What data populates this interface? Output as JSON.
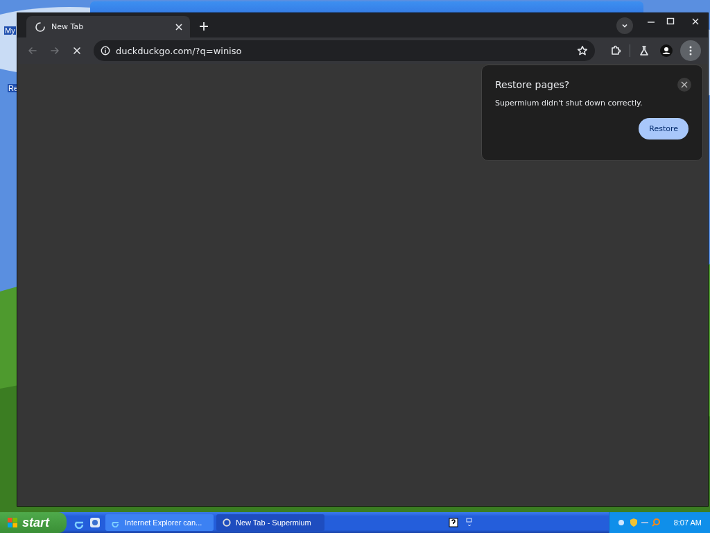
{
  "desktop": {
    "icons": [
      {
        "label": "My"
      },
      {
        "label": "Re"
      }
    ]
  },
  "browser": {
    "tabs": [
      {
        "title": "New Tab",
        "selected": true
      }
    ],
    "address": {
      "value": "duckduckgo.com/?q=winiso"
    },
    "popup": {
      "title": "Restore pages?",
      "message": "Supermium didn't shut down correctly.",
      "button": "Restore"
    }
  },
  "taskbar": {
    "start": "start",
    "tasks": [
      {
        "label": "Internet Explorer can...",
        "selected": false
      },
      {
        "label": "New Tab - Supermium",
        "selected": true
      }
    ],
    "clock": "8:07 AM"
  }
}
